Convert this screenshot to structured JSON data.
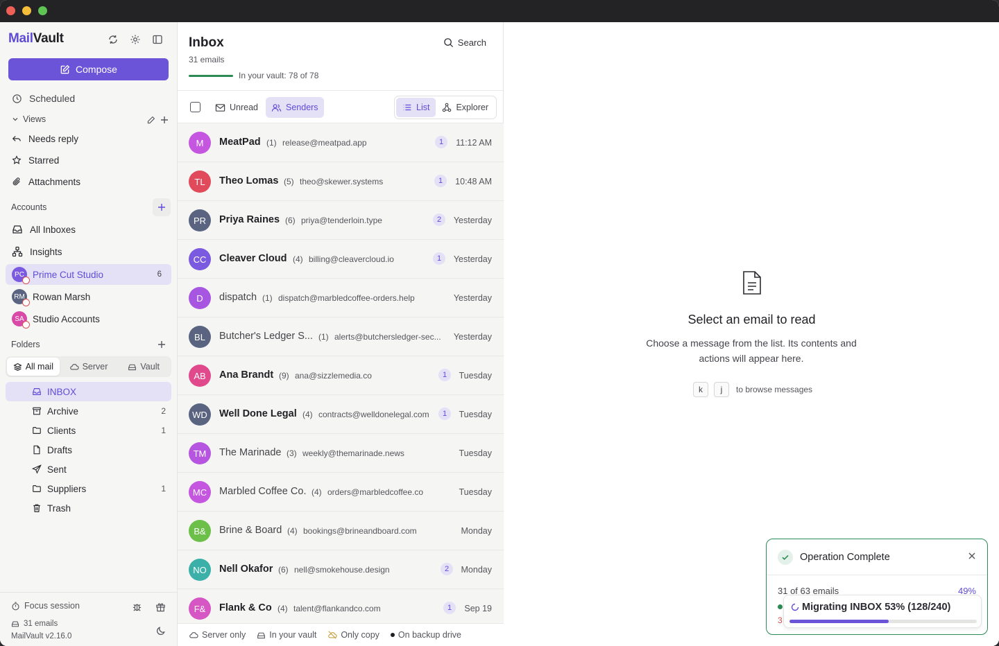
{
  "app": {
    "name_part1": "Mail",
    "name_part2": "Vault"
  },
  "sidebar": {
    "compose_label": "Compose",
    "scheduled_label": "Scheduled",
    "views_label": "Views",
    "views": [
      {
        "label": "Needs reply",
        "icon": "reply-icon"
      },
      {
        "label": "Starred",
        "icon": "star-icon"
      },
      {
        "label": "Attachments",
        "icon": "paperclip-icon"
      }
    ],
    "accounts_label": "Accounts",
    "accounts": [
      {
        "label": "All Inboxes",
        "icon": "inbox-icon"
      },
      {
        "label": "Insights",
        "icon": "network-icon"
      }
    ],
    "account_items": [
      {
        "label": "Prime Cut Studio",
        "initials": "PC",
        "color": "#7a5be0",
        "count": "6"
      },
      {
        "label": "Rowan Marsh",
        "initials": "RM",
        "color": "#5a6480"
      },
      {
        "label": "Studio Accounts",
        "initials": "SA",
        "color": "#d94aa8"
      }
    ],
    "folders_label": "Folders",
    "folder_tabs": [
      "All mail",
      "Server",
      "Vault"
    ],
    "folders": [
      {
        "label": "INBOX",
        "count": ""
      },
      {
        "label": "Archive",
        "count": "2"
      },
      {
        "label": "Clients",
        "count": "1"
      },
      {
        "label": "Drafts",
        "count": ""
      },
      {
        "label": "Sent",
        "count": ""
      },
      {
        "label": "Suppliers",
        "count": "1"
      },
      {
        "label": "Trash",
        "count": ""
      }
    ],
    "footer": {
      "focus_label": "Focus session",
      "emails_label": "31 emails",
      "version": "MailVault v2.16.0"
    }
  },
  "list": {
    "title": "Inbox",
    "count": "31 emails",
    "search_label": "Search",
    "vault_text": "In your vault: 78 of 78",
    "vault_progress": 1.0,
    "filters": {
      "unread": "Unread",
      "senders": "Senders"
    },
    "view_modes": {
      "list": "List",
      "explorer": "Explorer"
    },
    "rows": [
      {
        "initials": "M",
        "color": "#c456e0",
        "name": "MeatPad",
        "bold": true,
        "count": "(1)",
        "email": "release@meatpad.app",
        "unread": "1",
        "time": "11:12 AM"
      },
      {
        "initials": "TL",
        "color": "#e04a5a",
        "name": "Theo Lomas",
        "bold": true,
        "count": "(5)",
        "email": "theo@skewer.systems",
        "unread": "1",
        "time": "10:48 AM"
      },
      {
        "initials": "PR",
        "color": "#5a6480",
        "name": "Priya Raines",
        "bold": true,
        "count": "(6)",
        "email": "priya@tenderloin.type",
        "unread": "2",
        "time": "Yesterday"
      },
      {
        "initials": "CC",
        "color": "#7a5be0",
        "name": "Cleaver Cloud",
        "bold": true,
        "count": "(4)",
        "email": "billing@cleavercloud.io",
        "unread": "1",
        "time": "Yesterday"
      },
      {
        "initials": "D",
        "color": "#a656e0",
        "name": "dispatch",
        "bold": false,
        "count": "(1)",
        "email": "dispatch@marbledcoffee-orders.help",
        "unread": "",
        "time": "Yesterday"
      },
      {
        "initials": "BL",
        "color": "#5a6480",
        "name": "Butcher's Ledger S...",
        "bold": false,
        "count": "(1)",
        "email": "alerts@butchersledger-sec...",
        "unread": "",
        "time": "Yesterday"
      },
      {
        "initials": "AB",
        "color": "#e04a8c",
        "name": "Ana Brandt",
        "bold": true,
        "count": "(9)",
        "email": "ana@sizzlemedia.co",
        "unread": "1",
        "time": "Tuesday"
      },
      {
        "initials": "WD",
        "color": "#5a6480",
        "name": "Well Done Legal",
        "bold": true,
        "count": "(4)",
        "email": "contracts@welldonelegal.com",
        "unread": "1",
        "time": "Tuesday"
      },
      {
        "initials": "TM",
        "color": "#b656e0",
        "name": "The Marinade",
        "bold": false,
        "count": "(3)",
        "email": "weekly@themarinade.news",
        "unread": "",
        "time": "Tuesday"
      },
      {
        "initials": "MC",
        "color": "#c456e0",
        "name": "Marbled Coffee Co.",
        "bold": false,
        "count": "(4)",
        "email": "orders@marbledcoffee.co",
        "unread": "",
        "time": "Tuesday"
      },
      {
        "initials": "B&",
        "color": "#6cc04a",
        "name": "Brine & Board",
        "bold": false,
        "count": "(4)",
        "email": "bookings@brineandboard.com",
        "unread": "",
        "time": "Monday"
      },
      {
        "initials": "NO",
        "color": "#3ab0a8",
        "name": "Nell Okafor",
        "bold": true,
        "count": "(6)",
        "email": "nell@smokehouse.design",
        "unread": "2",
        "time": "Monday"
      },
      {
        "initials": "F&",
        "color": "#d656c4",
        "name": "Flank & Co",
        "bold": true,
        "count": "(4)",
        "email": "talent@flankandco.com",
        "unread": "1",
        "time": "Sep 19"
      }
    ],
    "legend": [
      "Server only",
      "In your vault",
      "Only copy",
      "On backup drive"
    ]
  },
  "reading": {
    "title": "Select an email to read",
    "description": "Choose a message from the list. Its contents and actions will appear here.",
    "key1": "k",
    "key2": "j",
    "browse_hint": "to browse messages"
  },
  "toast": {
    "title": "Operation Complete",
    "subtitle": "31 of 63 emails",
    "percent": "49%",
    "migration": "Migrating INBOX 53% (128/240)",
    "migration_progress": 0.53,
    "hidden_count": "3"
  },
  "colors": {
    "accent": "#6c54d8",
    "accent_soft": "#e4e0f6",
    "success": "#2c8a55"
  }
}
